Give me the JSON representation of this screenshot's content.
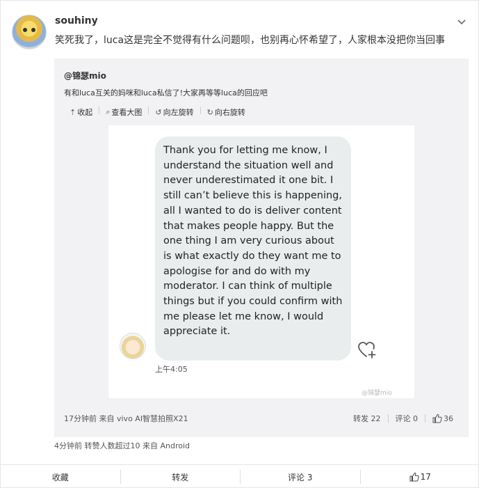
{
  "post": {
    "username": "souhiny",
    "text": "笑死我了，luca这是完全不觉得有什么问题呗，也别再心怀希望了，人家根本没把你当回事",
    "meta": "4分钟前 转赞人数超过10  来自 Android"
  },
  "repost": {
    "user": "@锦瑟mio",
    "text": "有和luca互关的妈咪和luca私信了!大家再等等luca的回应吧",
    "tools": [
      {
        "icon": "collapse-icon",
        "label": "收起"
      },
      {
        "icon": "search-icon",
        "label": "查看大图"
      },
      {
        "icon": "rotate-left-icon",
        "label": "向左旋转"
      },
      {
        "icon": "rotate-right-icon",
        "label": "向右旋转"
      }
    ],
    "image": {
      "message": "Thank you for letting me know, I understand the situation well and never underestimated it one bit. I still can’t believe this is happening, all I wanted to do is deliver content that makes people happy. But the one thing I am very curious about is what exactly do they want me to apologise for and do with my moderator. I can think of multiple things but if you could confirm with me please let me know, I would appreciate it.",
      "time": "上午4:05",
      "watermark": "@锦瑟mio"
    },
    "meta_left": "17分钟前 来自 vivo AI智慧拍照X21",
    "forward": "转发 22",
    "comment": "评论 0",
    "like_count": "36"
  },
  "actions": {
    "favorite": "收藏",
    "forward": "转发",
    "comment": "评论 3",
    "like": "17"
  },
  "colors": {
    "repost_bg": "#f2f2f5",
    "bubble_bg": "#e9edee",
    "border": "#e6e6e6"
  }
}
